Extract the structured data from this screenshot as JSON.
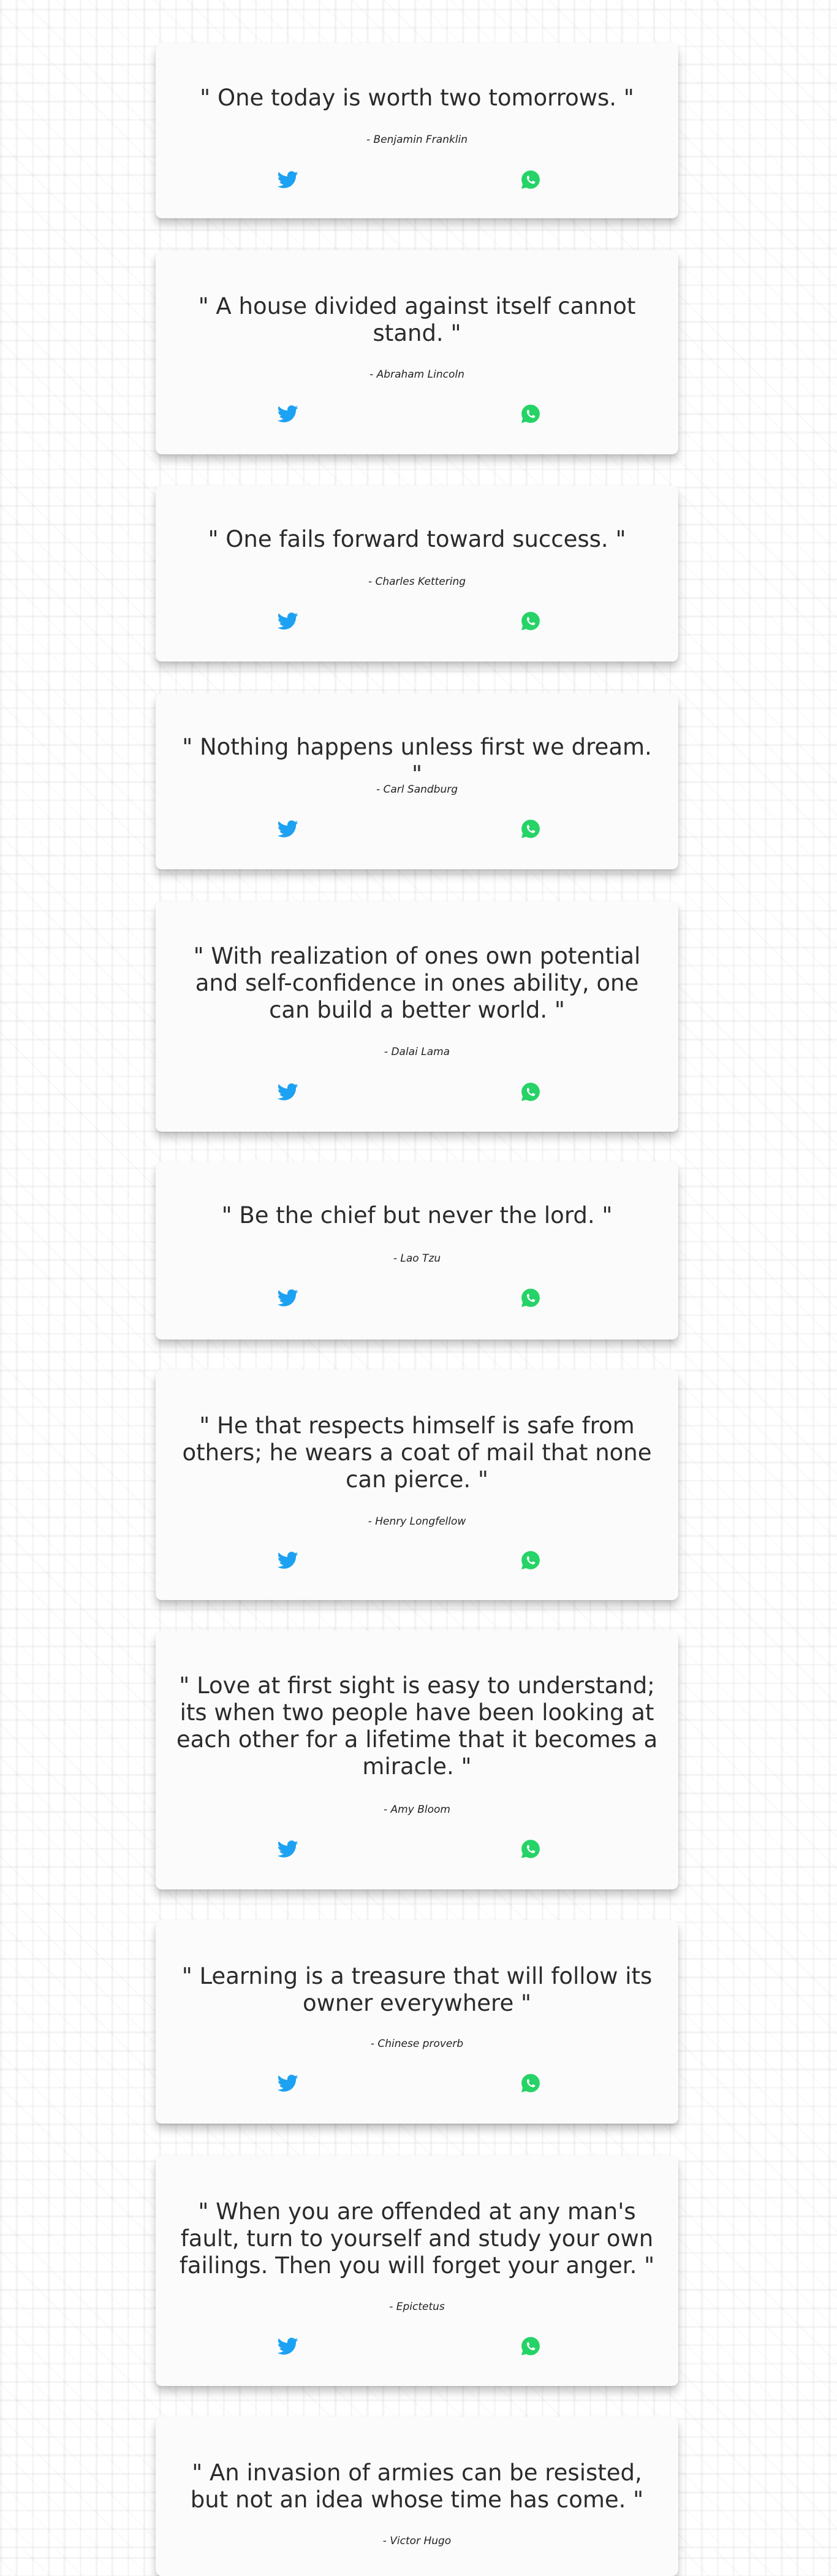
{
  "colors": {
    "twitter": "#1da1f2",
    "whatsapp": "#25d366",
    "text": "#2b2b2b",
    "card": "#fbfbfb"
  },
  "icons": {
    "twitter": "twitter-icon",
    "whatsapp": "whatsapp-icon"
  },
  "quotes": [
    {
      "text": "\" One today is worth two tomorrows. \"",
      "author": "- Benjamin Franklin"
    },
    {
      "text": "\" A house divided against itself cannot stand. \"",
      "author": "- Abraham Lincoln"
    },
    {
      "text": "\" One fails forward toward success. \"",
      "author": "- Charles Kettering"
    },
    {
      "text": "\" Nothing happens unless first we dream. \"",
      "author": "- Carl Sandburg"
    },
    {
      "text": "\" With realization of ones own potential and self-confidence in ones ability, one can build a better world. \"",
      "author": "- Dalai Lama"
    },
    {
      "text": "\" Be the chief but never the lord. \"",
      "author": "- Lao Tzu"
    },
    {
      "text": "\" He that respects himself is safe from others; he wears a coat of mail that none can pierce. \"",
      "author": "- Henry Longfellow"
    },
    {
      "text": "\" Love at first sight is easy to understand; its when two people have been looking at each other for a lifetime that it becomes a miracle. \"",
      "author": "- Amy Bloom"
    },
    {
      "text": "\" Learning is a treasure that will follow its owner everywhere \"",
      "author": "- Chinese proverb"
    },
    {
      "text": "\" When you are offended at any man's fault, turn to yourself and study your own failings. Then you will forget your anger. \"",
      "author": "- Epictetus"
    },
    {
      "text": "\" An invasion of armies can be resisted, but not an idea whose time has come. \"",
      "author": "- Victor Hugo"
    }
  ]
}
